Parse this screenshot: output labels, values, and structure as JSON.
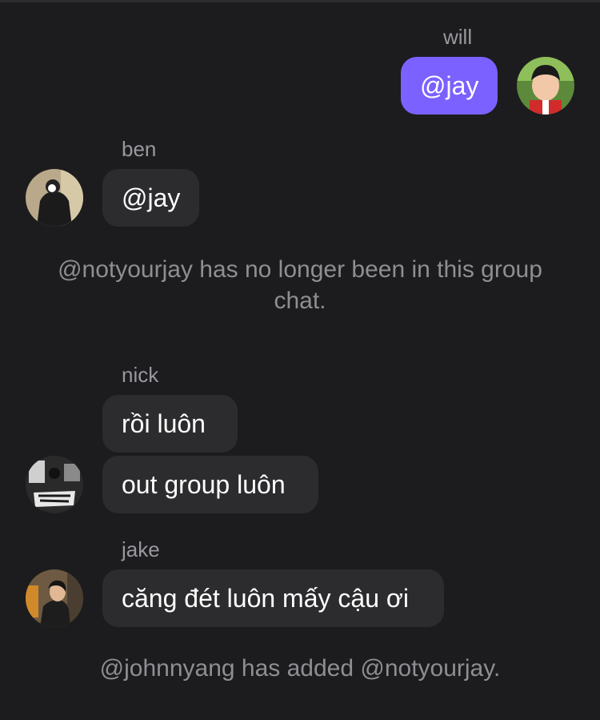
{
  "messages": {
    "will": {
      "sender": "will",
      "text": "@jay"
    },
    "ben": {
      "sender": "ben",
      "text": "@jay"
    },
    "nick": {
      "sender": "nick",
      "texts": [
        "rồi luôn",
        "out group luôn"
      ]
    },
    "jake": {
      "sender": "jake",
      "text": "căng đét luôn mấy cậu ơi"
    }
  },
  "system_messages": [
    "@notyourjay has no longer been in this group chat.",
    "@johnnyang has added @notyourjay."
  ],
  "colors": {
    "background": "#1c1c1e",
    "incoming_bubble": "#2c2c2e",
    "outgoing_bubble": "#7b61ff",
    "sender_label": "#98989f",
    "system_text": "#8e8e93"
  }
}
